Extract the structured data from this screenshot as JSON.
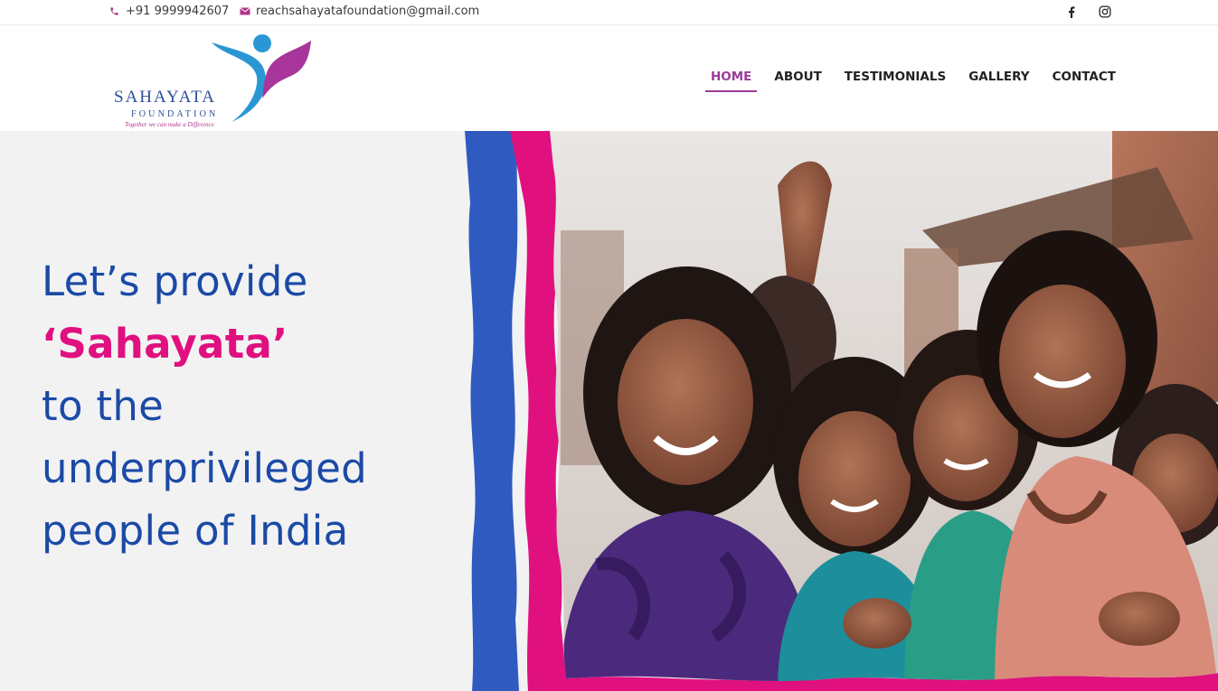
{
  "topbar": {
    "phone": "+91 9999942607",
    "email": "reachsahayatafoundation@gmail.com",
    "phone_icon": "phone-icon",
    "email_icon": "mail-icon",
    "social": [
      "facebook-icon",
      "instagram-icon"
    ]
  },
  "logo": {
    "name": "SAHAYATA",
    "sub": "FOUNDATION",
    "tagline": "Together we can make a Difference"
  },
  "nav": {
    "items": [
      {
        "label": "HOME",
        "active": true
      },
      {
        "label": "ABOUT",
        "active": false
      },
      {
        "label": "TESTIMONIALS",
        "active": false
      },
      {
        "label": "GALLERY",
        "active": false
      },
      {
        "label": "CONTACT",
        "active": false
      }
    ]
  },
  "hero": {
    "line1": "Let’s provide",
    "line2": "‘Sahayata’",
    "line3": "to the",
    "line4": "underprivileged",
    "line5": "people of India"
  },
  "colors": {
    "brand_blue": "#1b4aa6",
    "brand_pink": "#e0107f",
    "nav_active": "#9b3b9d",
    "stripe_blue": "#2f5bc0"
  }
}
